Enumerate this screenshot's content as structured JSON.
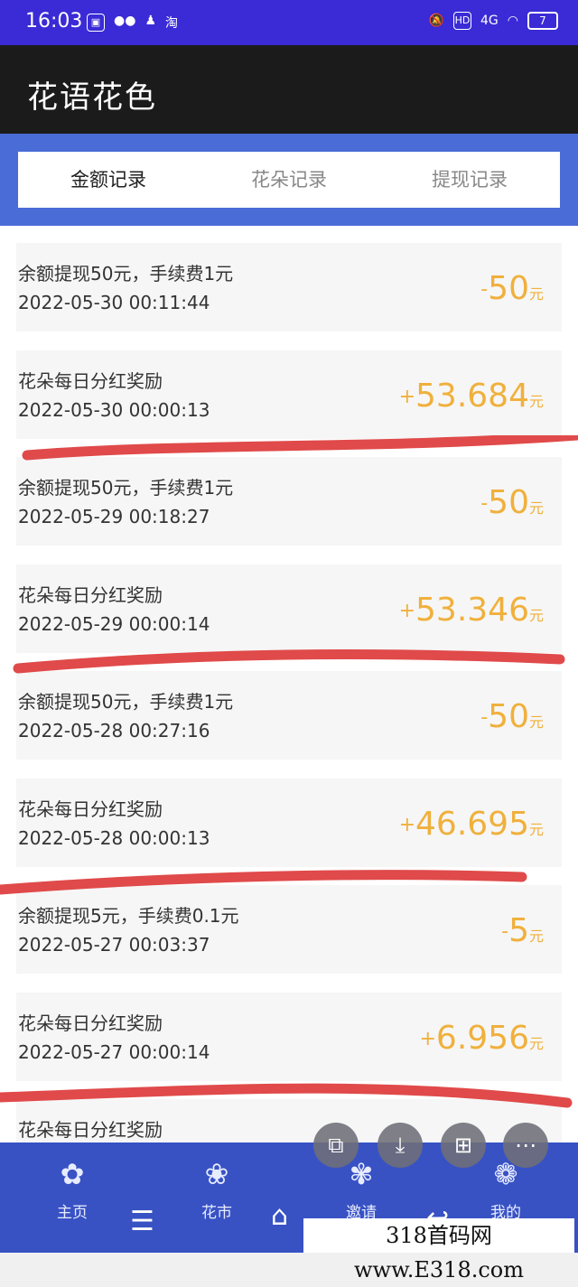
{
  "status": {
    "time": "16:03",
    "left_icons": [
      "gallery-icon",
      "wechat-icon",
      "qq-icon",
      "taobao-icon"
    ],
    "taobao_label": "淘",
    "hd_label": "HD",
    "signal_label": "4G",
    "battery": "7"
  },
  "app": {
    "title": "花语花色"
  },
  "tabs": [
    {
      "label": "金额记录",
      "active": true
    },
    {
      "label": "花朵记录",
      "active": false
    },
    {
      "label": "提现记录",
      "active": false
    }
  ],
  "records": [
    {
      "desc": "余额提现50元，手续费1元",
      "time": "2022-05-30 00:11:44",
      "sign": "-",
      "amount": "50",
      "unit": "元"
    },
    {
      "desc": "花朵每日分红奖励",
      "time": "2022-05-30 00:00:13",
      "sign": "+",
      "amount": "53.684",
      "unit": "元"
    },
    {
      "desc": "余额提现50元，手续费1元",
      "time": "2022-05-29 00:18:27",
      "sign": "-",
      "amount": "50",
      "unit": "元"
    },
    {
      "desc": "花朵每日分红奖励",
      "time": "2022-05-29 00:00:14",
      "sign": "+",
      "amount": "53.346",
      "unit": "元"
    },
    {
      "desc": "余额提现50元，手续费1元",
      "time": "2022-05-28 00:27:16",
      "sign": "-",
      "amount": "50",
      "unit": "元"
    },
    {
      "desc": "花朵每日分红奖励",
      "time": "2022-05-28 00:00:13",
      "sign": "+",
      "amount": "46.695",
      "unit": "元"
    },
    {
      "desc": "余额提现5元，手续费0.1元",
      "time": "2022-05-27 00:03:37",
      "sign": "-",
      "amount": "5",
      "unit": "元"
    },
    {
      "desc": "花朵每日分红奖励",
      "time": "2022-05-27 00:00:14",
      "sign": "+",
      "amount": "6.956",
      "unit": "元"
    },
    {
      "desc": "花朵每日分红奖励",
      "time": "",
      "sign": "",
      "amount": "",
      "unit": ""
    }
  ],
  "nav": [
    {
      "label": "主页",
      "icon": "home-flower-icon"
    },
    {
      "label": "花市",
      "icon": "flower-market-icon"
    },
    {
      "label": "邀请",
      "icon": "invite-flower-icon"
    },
    {
      "label": "我的",
      "icon": "profile-flower-icon"
    }
  ],
  "floating_buttons": [
    "translate-icon",
    "download-icon",
    "grid-icon",
    "more-icon"
  ],
  "system_nav": [
    "menu-icon",
    "home-icon",
    "back-icon"
  ],
  "watermark": "318首码网 www.E318.com",
  "colors": {
    "amount": "#f0b03c",
    "header": "#1b1b1b",
    "tab_bg": "#4a6cd6",
    "status_bar": "#3a2bd6",
    "annotation": "#e04a4a"
  }
}
